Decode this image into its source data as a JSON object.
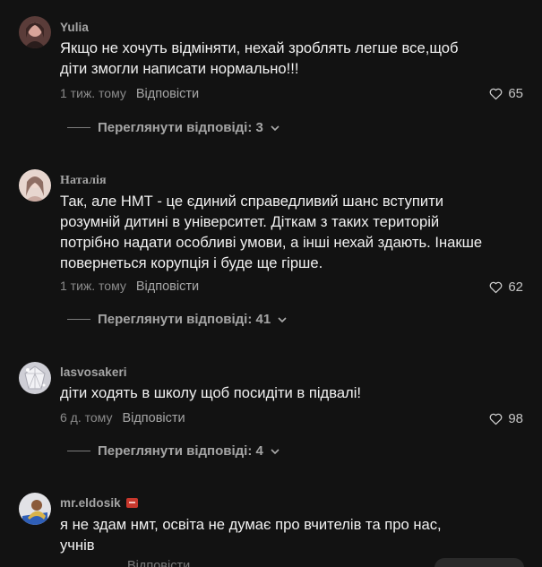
{
  "comments": [
    {
      "username": "Yulia",
      "text": "Якщо не хочуть відміняти, нехай зроблять легше все,щоб діти змогли написати нормально!!!",
      "time": "1 тиж. тому",
      "reply_label": "Відповісти",
      "likes": "65",
      "view_replies": "Переглянути відповіді: 3",
      "avatar_color": "#a8756b"
    },
    {
      "username": "Наталія",
      "text": "Так, але НМТ - це єдиний справедливий шанс вступити розумній дитині в університет. Діткам з таких територій потрібно надати особливі умови, а інші нехай здають. Інакше повернеться корупція і буде ще гірше.",
      "time": "1 тиж. тому",
      "reply_label": "Відповісти",
      "likes": "62",
      "view_replies": "Переглянути відповіді: 41",
      "avatar_color": "#d8c2b8"
    },
    {
      "username": "lasvosakeri",
      "text": "діти ходять в школу щоб посидіти в підвалі!",
      "time": "6 д. тому",
      "reply_label": "Відповісти",
      "likes": "98",
      "view_replies": "Переглянути відповіді: 4",
      "avatar_color": "#d9d9de"
    },
    {
      "username": "mr.eldosik",
      "text": "я не здам нмт, освіта не думає про вчителів та про нас, учнів",
      "time": "",
      "reply_label": "Відповісти",
      "likes": "",
      "avatar_color": "#3b4a6b"
    }
  ]
}
